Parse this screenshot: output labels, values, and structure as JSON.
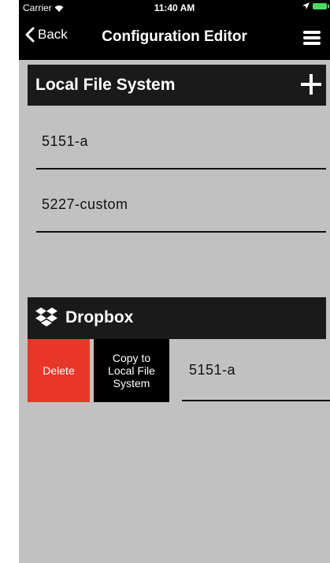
{
  "status_bar": {
    "carrier": "Carrier",
    "time": "11:40 AM"
  },
  "nav": {
    "back_label": "Back",
    "title": "Configuration Editor",
    "back_icon": "chevron-left-icon",
    "menu_icon": "hamburger-menu-icon"
  },
  "local_section": {
    "title": "Local File System",
    "add_icon": "plus-icon",
    "files": [
      {
        "name": "5151-a"
      },
      {
        "name": "5227-custom"
      }
    ]
  },
  "dropbox_section": {
    "title": "Dropbox",
    "icon": "dropbox-icon",
    "files": [
      {
        "name": "5151-a",
        "delete_label": "Delete",
        "copy_label": "Copy to Local File System"
      }
    ]
  },
  "colors": {
    "background": "#c1c1c1",
    "header": "#1a1a1a",
    "delete": "#e8372a",
    "copy": "#000000"
  }
}
